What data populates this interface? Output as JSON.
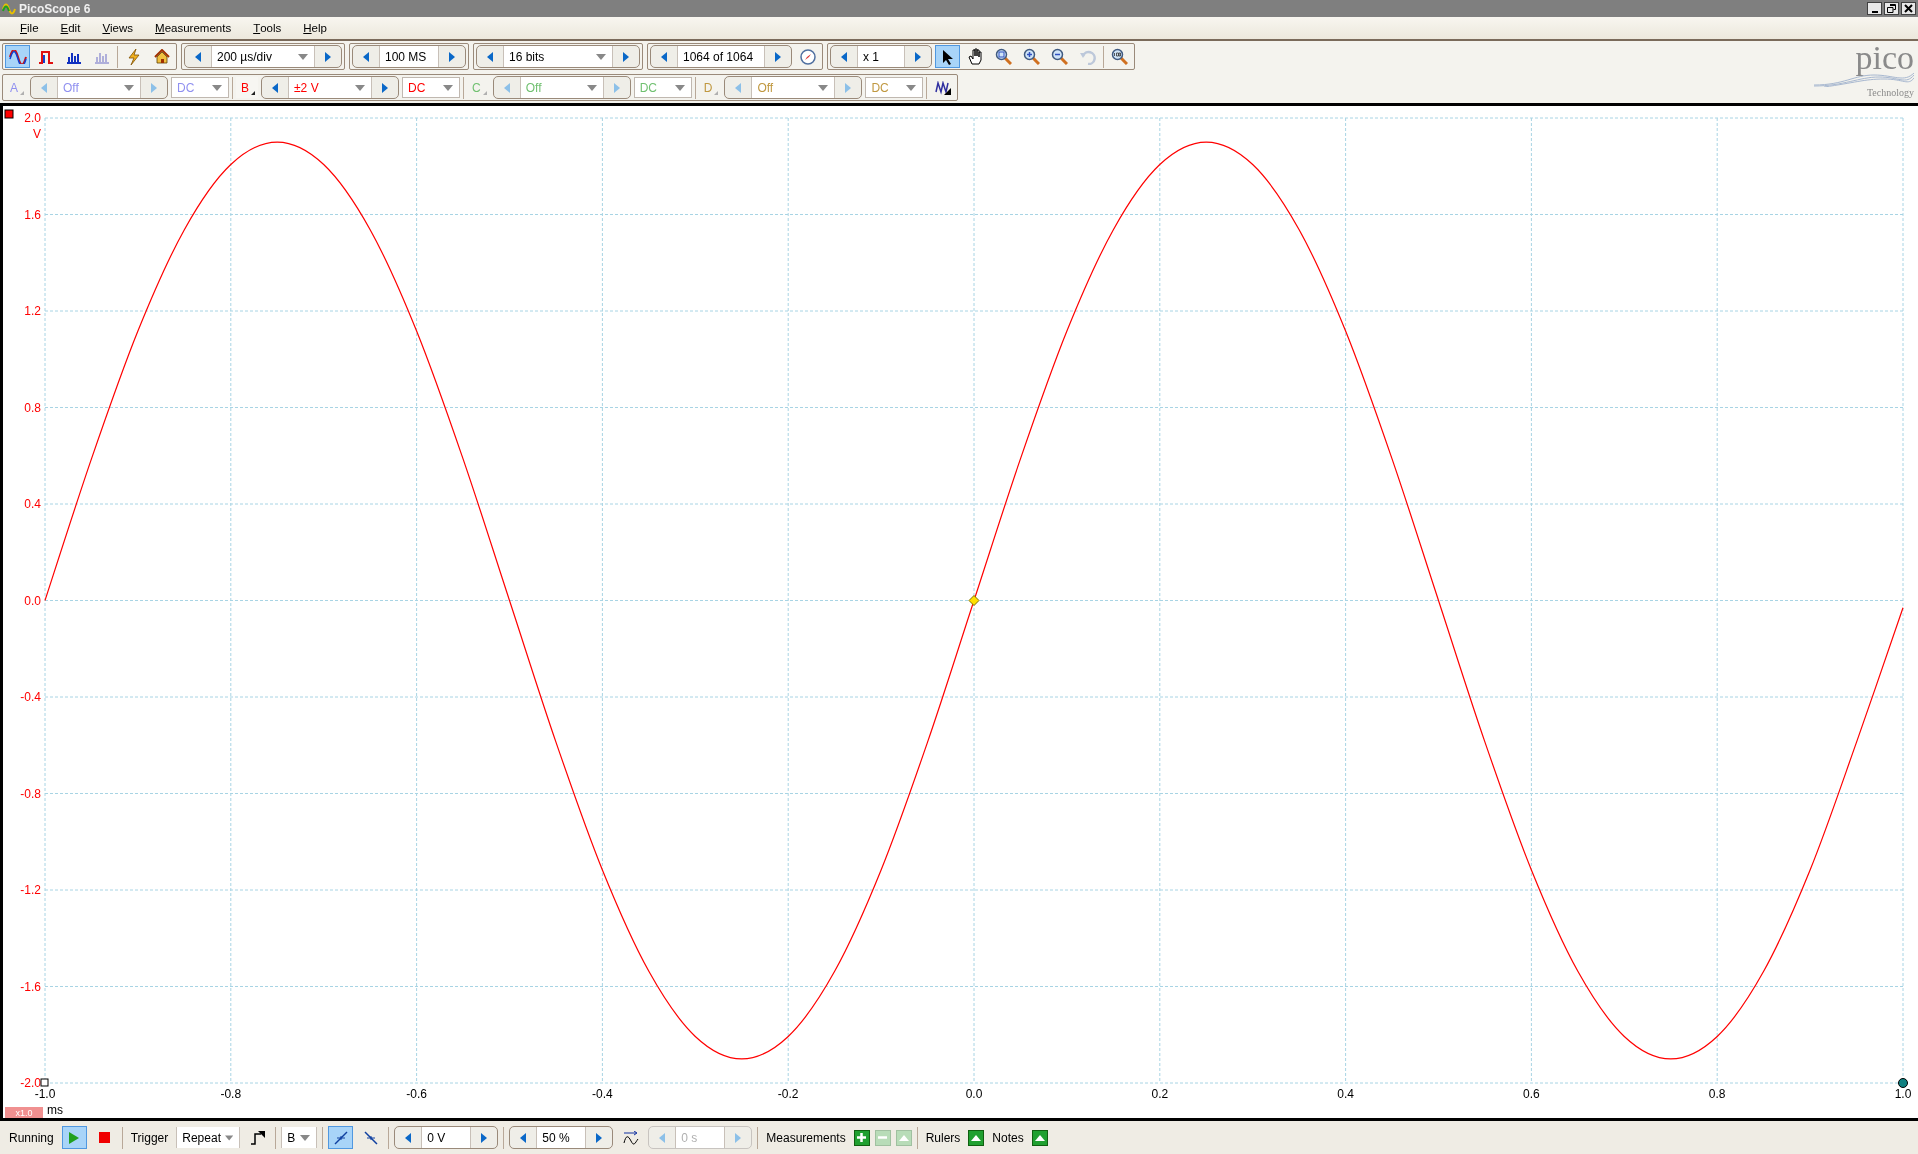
{
  "window": {
    "title": "PicoScope 6"
  },
  "menu": [
    {
      "label": "File"
    },
    {
      "label": "Edit"
    },
    {
      "label": "Views"
    },
    {
      "label": "Measurements"
    },
    {
      "label": "Tools"
    },
    {
      "label": "Help"
    }
  ],
  "toolbar": {
    "view_buttons": [
      {
        "kind": "scope",
        "selected": true,
        "disabled": false
      },
      {
        "kind": "persistence",
        "selected": false,
        "disabled": false
      },
      {
        "kind": "spectrum",
        "selected": false,
        "disabled": false
      },
      {
        "kind": "spectrum_add",
        "selected": false,
        "disabled": true
      }
    ],
    "timebase": "200 µs/div",
    "samples": "100 MS",
    "resolution": "16 bits",
    "buffer": "1064 of 1064",
    "zoom_factor": "x 1",
    "tools": [
      {
        "kind": "pointer",
        "selected": true,
        "disabled": false
      },
      {
        "kind": "hand",
        "selected": false,
        "disabled": false
      },
      {
        "kind": "zoom_fit",
        "selected": false,
        "disabled": false
      },
      {
        "kind": "zoom_in",
        "selected": false,
        "disabled": false
      },
      {
        "kind": "zoom_out",
        "selected": false,
        "disabled": false
      },
      {
        "kind": "undo",
        "selected": false,
        "disabled": true
      },
      {
        "kind": "zoom_100",
        "selected": false,
        "disabled": false
      }
    ]
  },
  "channels": [
    {
      "letter": "A",
      "range": "Off",
      "coupling": "DC",
      "enabled": false,
      "color": "#9090f0"
    },
    {
      "letter": "B",
      "range": "±2 V",
      "coupling": "DC",
      "enabled": true,
      "color": "#ff0000"
    },
    {
      "letter": "C",
      "range": "Off",
      "coupling": "DC",
      "enabled": false,
      "color": "#70c070"
    },
    {
      "letter": "D",
      "range": "Off",
      "coupling": "DC",
      "enabled": false,
      "color": "#c09840"
    }
  ],
  "logo": {
    "name": "pico",
    "subtitle": "Technology"
  },
  "scope": {
    "y_unit": "V",
    "x_unit": "ms",
    "x_scale": "x1.0",
    "chart_data": {
      "type": "line",
      "x": [
        -1.0,
        -0.95,
        -0.9,
        -0.85,
        -0.8,
        -0.75,
        -0.7,
        -0.65,
        -0.6,
        -0.55,
        -0.5,
        -0.45,
        -0.4,
        -0.35,
        -0.3,
        -0.25,
        -0.2,
        -0.15,
        -0.1,
        -0.05,
        0.0,
        0.05,
        0.1,
        0.15,
        0.2,
        0.25,
        0.3,
        0.35,
        0.4,
        0.45,
        0.5,
        0.55,
        0.6,
        0.65,
        0.7,
        0.75,
        0.8,
        0.85,
        0.9,
        0.95,
        1.0
      ],
      "grid": true,
      "series": [
        {
          "color": "#ff0000",
          "values": [
            0,
            0.587,
            1.117,
            1.537,
            1.807,
            1.9,
            1.807,
            1.537,
            1.117,
            0.587,
            0,
            -0.587,
            -1.117,
            -1.537,
            -1.807,
            -1.9,
            -1.807,
            -1.537,
            -1.117,
            -0.587,
            0,
            0.587,
            1.117,
            1.537,
            1.807,
            1.9,
            1.807,
            1.537,
            1.117,
            0.587,
            0,
            -0.587,
            -1.117,
            -1.537,
            -1.807,
            -1.9,
            -1.807,
            -1.537,
            -1.117,
            -0.587,
            -0.03
          ]
        }
      ],
      "xlim": [
        -1.0,
        1.0
      ],
      "ylim": [
        -2.0,
        2.0
      ],
      "xticks": [
        {
          "value": -1.0,
          "label": "-1.0"
        },
        {
          "value": -0.8,
          "label": "-0.8"
        },
        {
          "value": -0.6,
          "label": "-0.6"
        },
        {
          "value": -0.4,
          "label": "-0.4"
        },
        {
          "value": -0.2,
          "label": "-0.2"
        },
        {
          "value": 0,
          "label": "0.0"
        },
        {
          "value": 0.2,
          "label": "0.2"
        },
        {
          "value": 0.4,
          "label": "0.4"
        },
        {
          "value": 0.6,
          "label": "0.6"
        },
        {
          "value": 0.8,
          "label": "0.8"
        },
        {
          "value": 1.0,
          "label": "1.0"
        }
      ],
      "yticks": [
        {
          "value": 2.0,
          "label": "2.0"
        },
        {
          "value": 1.6,
          "label": "1.6"
        },
        {
          "value": 1.2,
          "label": "1.2"
        },
        {
          "value": 0.8,
          "label": "0.8"
        },
        {
          "value": 0.4,
          "label": "0.4"
        },
        {
          "value": 0,
          "label": "0.0"
        },
        {
          "value": -0.4,
          "label": "-0.4"
        },
        {
          "value": -0.8,
          "label": "-0.8"
        },
        {
          "value": -1.2,
          "label": "-1.2"
        },
        {
          "value": -1.6,
          "label": "-1.6"
        },
        {
          "value": -2.0,
          "label": "-2.0"
        }
      ]
    }
  },
  "bottom_bar": {
    "status": "Running",
    "running": true,
    "trigger_label": "Trigger",
    "trigger_mode": "Repeat",
    "trigger_source": "B",
    "edges": [
      {
        "kind": "rising",
        "selected": true
      },
      {
        "kind": "falling",
        "selected": false
      }
    ],
    "threshold": "0 V",
    "pre_trigger": "50 %",
    "delay": {
      "value": "0 s",
      "disabled": true
    },
    "measurements": "Measurements",
    "rulers": "Rulers",
    "notes": "Notes"
  }
}
